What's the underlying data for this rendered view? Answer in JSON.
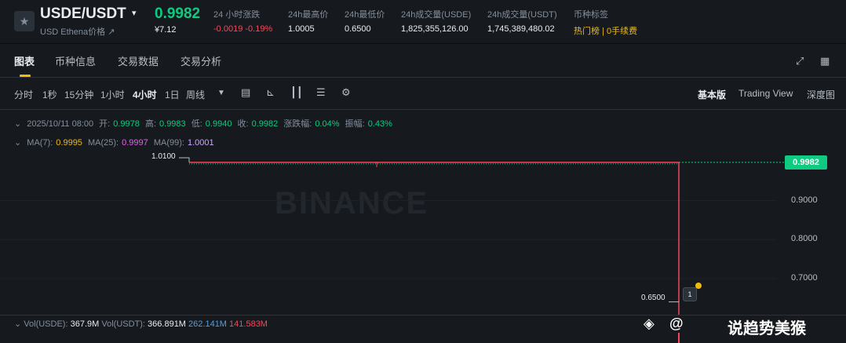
{
  "ticker": {
    "symbol": "USDE/USDT",
    "subtitle": "USD Ethena价格",
    "subtitle_icon": "external-link-icon",
    "price": "0.9982",
    "price_fiat": "¥7.12",
    "stats": [
      {
        "key": "24 小时涨跌",
        "value": "-0.0019 -0.19%"
      },
      {
        "key": "24h最高价",
        "value": "1.0005"
      },
      {
        "key": "24h最低价",
        "value": "0.6500"
      },
      {
        "key": "24h成交量(USDE)",
        "value": "1,825,355,126.00"
      },
      {
        "key": "24h成交量(USDT)",
        "value": "1,745,389,480.02"
      },
      {
        "key": "币种标签",
        "value": "热门榜 | 0手续费"
      }
    ]
  },
  "tabs": [
    "图表",
    "币种信息",
    "交易数据",
    "交易分析"
  ],
  "intervals": [
    "分时",
    "1秒",
    "15分钟",
    "1小时",
    "4小时",
    "1日",
    "周线"
  ],
  "active_interval": "4小时",
  "views": [
    "基本版",
    "Trading View",
    "深度图"
  ],
  "ohlc": {
    "date": "2025/10/11 08:00",
    "open_label": "开:",
    "open": "0.9978",
    "high_label": "高:",
    "high": "0.9983",
    "low_label": "低:",
    "low": "0.9940",
    "close_label": "收:",
    "close": "0.9982",
    "change_label": "涨跌幅:",
    "change": "0.04%",
    "amp_label": "振幅:",
    "amp": "0.43%"
  },
  "ma": {
    "ma7_label": "MA(7):",
    "ma7": "0.9995",
    "ma25_label": "MA(25):",
    "ma25": "0.9997",
    "ma99_label": "MA(99):",
    "ma99": "1.0001"
  },
  "chart_data": {
    "type": "line",
    "y_ticks": [
      0.9,
      0.8,
      0.7
    ],
    "ylim": [
      0.63,
      1.02
    ],
    "current_price": 0.9982,
    "high_marker": 1.01,
    "low_marker": 0.65,
    "high_marker_label": "1.0100",
    "low_marker_label": "0.6500",
    "current_price_label": "0.9982",
    "axis_labels": [
      "0.9000",
      "0.8000",
      "0.7000"
    ],
    "watermark": "BINANCE",
    "series_color": "#f6465d"
  },
  "volume": {
    "vol_usde_label": "Vol(USDE):",
    "vol_usde": "367.9M",
    "vol_usdt_label": "Vol(USDT):",
    "vol_usdt": "366.891M",
    "extra1": "262.141M",
    "extra2": "141.583M",
    "overlay_at": "@",
    "overlay_text": "说趋势美猴"
  }
}
